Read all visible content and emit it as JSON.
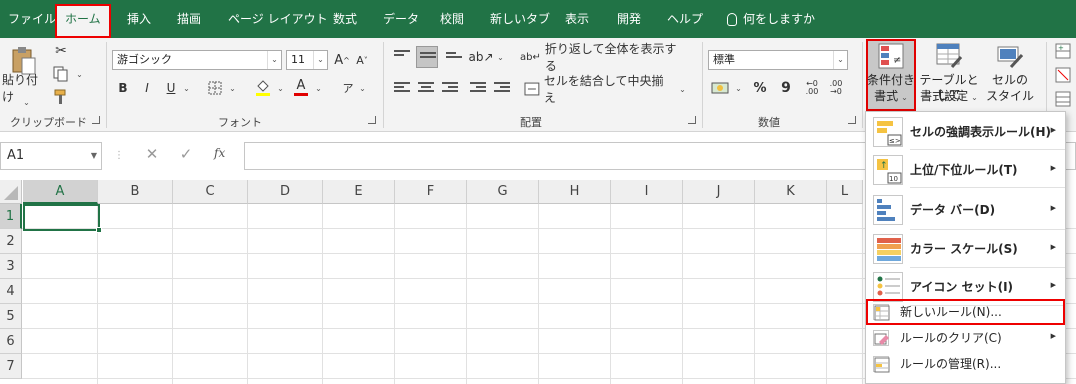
{
  "tabs": [
    "ファイル",
    "ホーム",
    "挿入",
    "描画",
    "ページ レイアウト",
    "数式",
    "データ",
    "校閲",
    "新しいタブ",
    "表示",
    "開発",
    "ヘルプ"
  ],
  "tell_me": "何をしますか",
  "clipboard": {
    "paste_label": "貼り付け",
    "group_label": "クリップボード"
  },
  "font": {
    "name": "游ゴシック",
    "size": "11",
    "bold": "B",
    "italic": "I",
    "underline": "U",
    "font_color_glyph": "A",
    "phonetic_glyph": "ア",
    "group_label": "フォント"
  },
  "alignment": {
    "wrap_text": "折り返して全体を表示する",
    "merge_center": "セルを結合して中央揃え",
    "group_label": "配置"
  },
  "number": {
    "format": "標準",
    "percent": "%",
    "comma": "9",
    "group_label": "数値"
  },
  "styles": {
    "conditional_formatting": [
      "条件付き",
      "書式"
    ],
    "format_as_table": [
      "テーブルとして",
      "書式設定"
    ],
    "cell_styles": [
      "セルの",
      "スタイル"
    ]
  },
  "formula_bar": {
    "name_box": "A1",
    "fx": "fx",
    "cancel": "✕",
    "enter": "✓"
  },
  "columns": [
    "A",
    "B",
    "C",
    "D",
    "E",
    "F",
    "G",
    "H",
    "I",
    "J",
    "K",
    "L"
  ],
  "rows": [
    "1",
    "2",
    "3",
    "4",
    "5",
    "6",
    "7"
  ],
  "menu": {
    "items": [
      {
        "label": "セルの強調表示ルール(H)",
        "submenu": true,
        "icon": "highlight-rules-icon"
      },
      {
        "label": "上位/下位ルール(T)",
        "submenu": true,
        "icon": "top-bottom-rules-icon"
      },
      {
        "label": "データ バー(D)",
        "submenu": true,
        "icon": "data-bars-icon"
      },
      {
        "label": "カラー スケール(S)",
        "submenu": true,
        "icon": "color-scales-icon"
      },
      {
        "label": "アイコン セット(I)",
        "submenu": true,
        "icon": "icon-sets-icon"
      },
      {
        "label": "新しいルール(N)...",
        "submenu": false,
        "icon": "new-rule-icon"
      },
      {
        "label": "ルールのクリア(C)",
        "submenu": true,
        "icon": "clear-rules-icon"
      },
      {
        "label": "ルールの管理(R)...",
        "submenu": false,
        "icon": "manage-rules-icon"
      }
    ]
  },
  "colors": {
    "excel_green": "#217346",
    "highlight_red": "#e00000",
    "ribbon_bg": "#f3f3f3"
  }
}
